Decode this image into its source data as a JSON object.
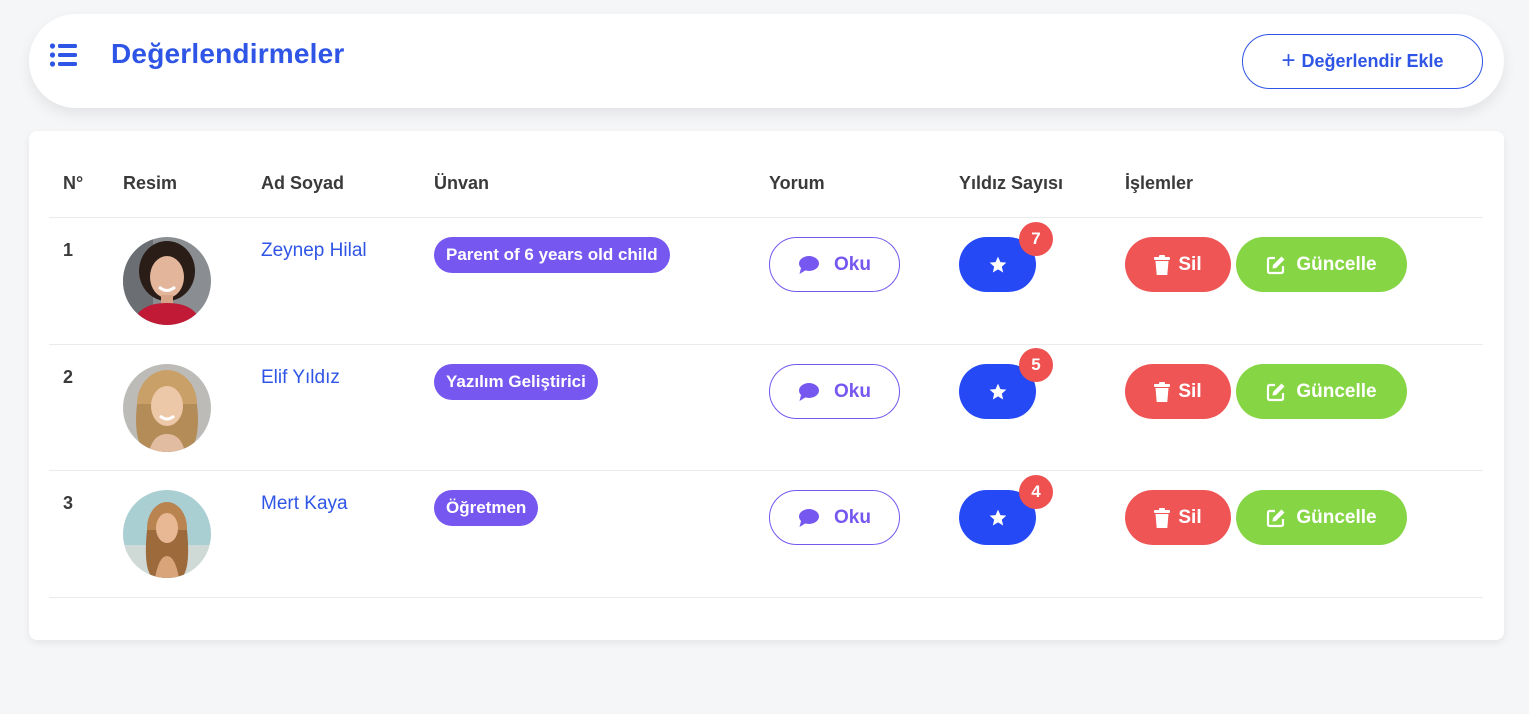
{
  "header": {
    "title": "Değerlendirmeler",
    "add_button_label": "Değerlendir Ekle",
    "menu_icon": "list-icon",
    "add_icon": "plus-icon"
  },
  "table": {
    "columns": [
      "N°",
      "Resim",
      "Ad Soyad",
      "Ünvan",
      "Yorum",
      "Yıldız Sayısı",
      "İşlemler"
    ],
    "rows": [
      {
        "num": "1",
        "name": "Zeynep Hilal",
        "title": "Parent of 6 years old child",
        "read_label": "Oku",
        "stars": "7",
        "delete_label": "Sil",
        "update_label": "Güncelle"
      },
      {
        "num": "2",
        "name": "Elif Yıldız",
        "title": "Yazılım Geliştirici",
        "read_label": "Oku",
        "stars": "5",
        "delete_label": "Sil",
        "update_label": "Güncelle"
      },
      {
        "num": "3",
        "name": "Mert Kaya",
        "title": "Öğretmen",
        "read_label": "Oku",
        "stars": "4",
        "delete_label": "Sil",
        "update_label": "Güncelle"
      }
    ]
  },
  "icons": {
    "read": "comment-icon",
    "star": "star-icon",
    "delete": "trash-icon",
    "update": "edit-icon"
  },
  "colors": {
    "primary": "#2f55e6",
    "star_button": "#2549f5",
    "badge_purple": "#7657f0",
    "count_red": "#ef5050",
    "delete_red": "#ef5555",
    "update_green": "#86d545"
  }
}
